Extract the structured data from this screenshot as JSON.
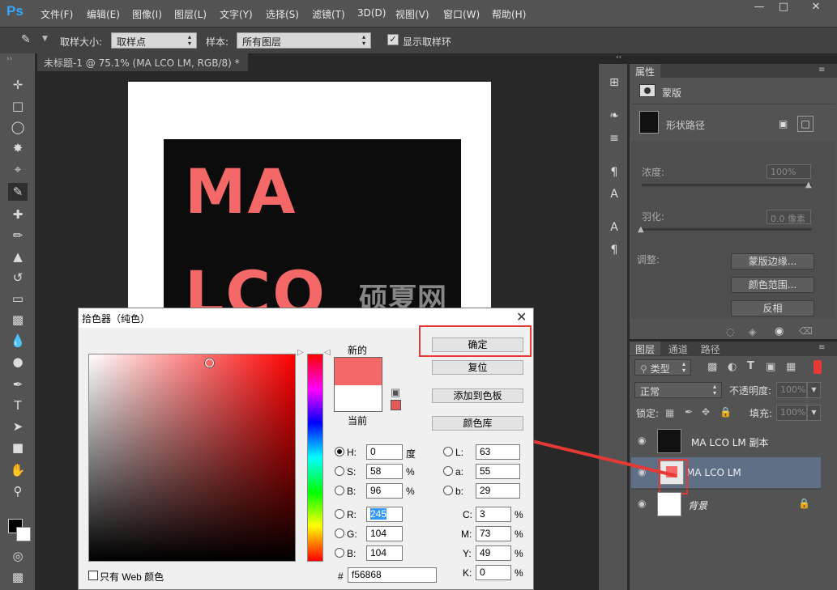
{
  "menubar": {
    "logo": "Ps",
    "items": [
      "文件(F)",
      "编辑(E)",
      "图像(I)",
      "图层(L)",
      "文字(Y)",
      "选择(S)",
      "滤镜(T)",
      "3D(D)",
      "视图(V)",
      "窗口(W)",
      "帮助(H)"
    ]
  },
  "options": {
    "sample_size_label": "取样大小:",
    "sample_size_value": "取样点",
    "sample_label": "样本:",
    "sample_value": "所有图层",
    "show_ring_label": "显示取样环"
  },
  "document": {
    "tab_title": "未标题-1 @ 75.1% (MA LCO LM, RGB/8) *",
    "text_line1": "MA",
    "text_line2": "LCO",
    "watermark": "硕夏网"
  },
  "properties": {
    "tab": "属性",
    "mask_label": "蒙版",
    "shape_path_label": "形状路径",
    "density_label": "浓度:",
    "density_value": "100%",
    "feather_label": "羽化:",
    "feather_value": "0.0 像素",
    "adjust_label": "调整:",
    "btn_mask_edge": "蒙版边缘...",
    "btn_color_range": "颜色范围...",
    "btn_invert": "反相"
  },
  "layers_panel": {
    "tabs": [
      "图层",
      "通道",
      "路径"
    ],
    "filter_kind": "类型",
    "blend_mode": "正常",
    "opacity_label": "不透明度:",
    "opacity_value": "100%",
    "lock_label": "锁定:",
    "fill_label": "填充:",
    "fill_value": "100%",
    "layers": [
      {
        "name": "MA LCO LM 副本"
      },
      {
        "name": "MA LCO LM"
      },
      {
        "name": "背景"
      }
    ]
  },
  "color_picker": {
    "title": "拾色器（纯色）",
    "new_label": "新的",
    "current_label": "当前",
    "ok": "确定",
    "reset": "复位",
    "add_swatch": "添加到色板",
    "color_library": "颜色库",
    "web_only": "只有 Web 颜色",
    "H_label": "H:",
    "H": "0",
    "H_unit": "度",
    "S_label": "S:",
    "S": "58",
    "S_unit": "%",
    "Bv_label": "B:",
    "Bv": "96",
    "Bv_unit": "%",
    "R_label": "R:",
    "R": "245",
    "G_label": "G:",
    "G": "104",
    "B_label": "B:",
    "B": "104",
    "L_label": "L:",
    "L": "63",
    "a_label": "a:",
    "a": "55",
    "b_label": "b:",
    "b": "29",
    "C_label": "C:",
    "C": "3",
    "M_label": "M:",
    "M": "73",
    "Y_label": "Y:",
    "Y": "49",
    "K_label": "K:",
    "K": "0",
    "pct": "%",
    "hash": "#",
    "hex": "f56868",
    "new_color": "#f56868",
    "current_color": "#ffffff"
  },
  "colors": {
    "accent": "#f56868",
    "highlight": "#e53935"
  }
}
